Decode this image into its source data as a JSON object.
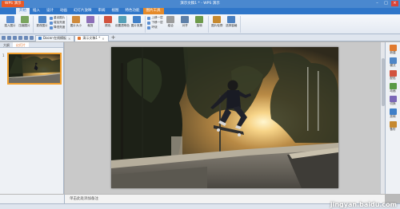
{
  "titlebar": {
    "app_button": "WPS 演示",
    "title": "演示文稿1 * - WPS 演示",
    "minimize": "–",
    "maximize": "□",
    "close": "×"
  },
  "menu": {
    "items": [
      {
        "label": "开始"
      },
      {
        "label": "插入"
      },
      {
        "label": "设计"
      },
      {
        "label": "动画"
      },
      {
        "label": "幻灯片放映"
      },
      {
        "label": "审阅"
      },
      {
        "label": "视图"
      },
      {
        "label": "特色功能"
      },
      {
        "label": "图片工具"
      }
    ]
  },
  "ribbon": {
    "buttons": [
      {
        "label": "插入图片",
        "color": "#5b8ed1"
      },
      {
        "label": "压缩图片",
        "color": "#7aa55e"
      },
      {
        "label": "更改图片",
        "color": "#4f86c6"
      },
      {
        "label": "图片大小",
        "color": "#cf8a3b"
      },
      {
        "label": "裁剪",
        "color": "#8d6fb8"
      },
      {
        "label": "颜色",
        "color": "#d2533e"
      },
      {
        "label": "设置透明色",
        "color": "#54a0b7"
      },
      {
        "label": "图片效果",
        "color": "#3f7fc8"
      },
      {
        "label": "组合",
        "color": "#9b9b9b"
      },
      {
        "label": "对齐",
        "color": "#5d7fa8"
      },
      {
        "label": "旋转",
        "color": "#6d9a4a"
      },
      {
        "label": "图片轮廓",
        "color": "#c6892f"
      },
      {
        "label": "选择窗格",
        "color": "#4a7fbf"
      }
    ],
    "small": [
      "重设图片",
      "增加亮度",
      "降低亮度",
      "上移一层",
      "下移一层",
      "环绕"
    ]
  },
  "tabs": {
    "items": [
      {
        "label": "Docer-在线模板",
        "active": false
      },
      {
        "label": "演示文稿1 *",
        "active": true
      }
    ],
    "add": "+"
  },
  "leftpanel": {
    "tabs": [
      "大纲",
      "幻灯片"
    ],
    "thumb_number": "1"
  },
  "rightpane": {
    "items": [
      {
        "label": "新建",
        "color": "#e07a2f"
      },
      {
        "label": "模式",
        "color": "#4f86c6"
      },
      {
        "label": "配色",
        "color": "#d2533e"
      },
      {
        "label": "动画",
        "color": "#5a9a45"
      },
      {
        "label": "切换",
        "color": "#7b67b6"
      },
      {
        "label": "放映",
        "color": "#3f7fc8"
      },
      {
        "label": "备份",
        "color": "#c6892f"
      }
    ]
  },
  "notes": {
    "placeholder": "单击此处添加备注"
  },
  "watermark": "jingyan.baidu.com"
}
